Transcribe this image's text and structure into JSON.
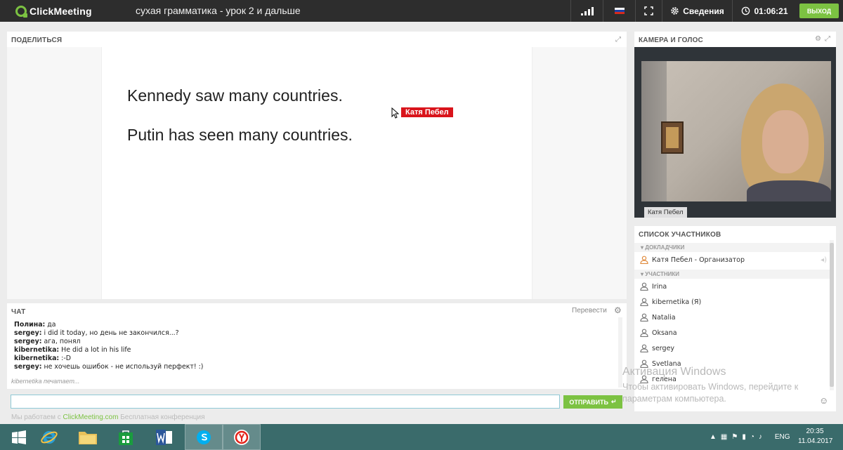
{
  "app": {
    "name": "ClickMeeting",
    "meeting_title": "сухая грамматика - урок 2 и дальше"
  },
  "topbar": {
    "info_label": "Сведения",
    "timer": "01:06:21",
    "exit_label": "ВЫХОД",
    "flag_colors": [
      "#ffffff",
      "#1c3fa8",
      "#d52b1e"
    ]
  },
  "share": {
    "title": "ПОДЕЛИТЬСЯ",
    "slide_lines": [
      "Kennedy saw many countries.",
      "Putin has seen many countries."
    ],
    "cursor_label": "Катя Пебел"
  },
  "chat": {
    "title": "ЧАТ",
    "translate_label": "Перевести",
    "messages": [
      {
        "author": "Полина:",
        "text": "да"
      },
      {
        "author": "sergey:",
        "text": "i did it today, но день не закончился...?"
      },
      {
        "author": "sergey:",
        "text": "ага, понял"
      },
      {
        "author": "kibernetika:",
        "text": "He did a lot  in his life"
      },
      {
        "author": "kibernetika:",
        "text": ":-D"
      },
      {
        "author": "sergey:",
        "text": "не хочешь ошибок - не используй перфект! :)"
      }
    ],
    "typing_status": "kibernetika печатает...",
    "input_value": "",
    "send_label": "ОТПРАВИТЬ",
    "powered_prefix": "Мы работаем с",
    "powered_link": "ClickMeeting.com",
    "powered_suffix": "Бесплатная конференция"
  },
  "camera": {
    "title": "КАМЕРА И ГОЛОС",
    "speaker_name": "Катя Пебел"
  },
  "participants": {
    "title": "СПИСОК УЧАСТНИКОВ",
    "presenters_label": "ДОКЛАДЧИКИ",
    "presenters": [
      "Катя Пебел - Организатор"
    ],
    "attendees_label": "УЧАСТНИКИ",
    "attendees": [
      "Irina",
      "kibernetika  (Я)",
      "Natalia",
      "Oksana",
      "sergey",
      "Svetlana",
      "гелена"
    ]
  },
  "windows": {
    "activate_title": "Активация Windows",
    "activate_sub": "Чтобы активировать Windows, перейдите к параметрам компьютера.",
    "lang": "ENG",
    "time": "20:35",
    "date": "11.04.2017"
  },
  "colors": {
    "accent_green": "#7cc242",
    "topbar": "#2d2d2d",
    "taskbar": "#3a6b6b",
    "cursor_label_bg": "#d9141b"
  }
}
